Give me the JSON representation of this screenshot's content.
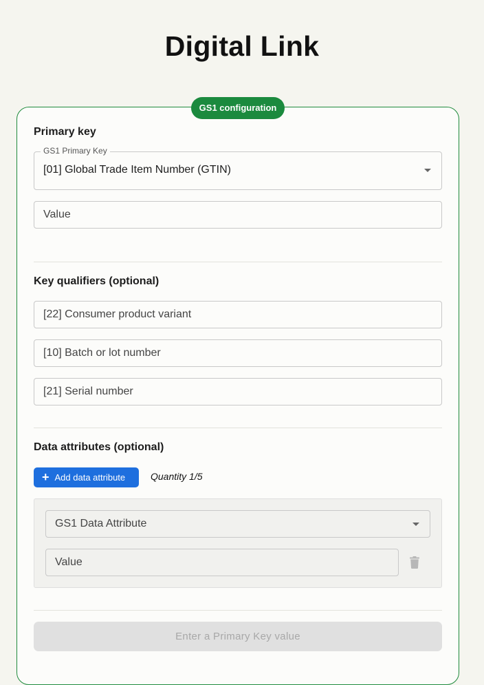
{
  "page": {
    "title": "Digital Link"
  },
  "card": {
    "badge": "GS1 configuration"
  },
  "primary_key": {
    "section_title": "Primary key",
    "select_label": "GS1 Primary Key",
    "select_value": "[01] Global Trade Item Number (GTIN)",
    "value_placeholder": "Value"
  },
  "key_qualifiers": {
    "section_title": "Key qualifiers (optional)",
    "fields": [
      {
        "placeholder": "[22] Consumer product variant"
      },
      {
        "placeholder": "[10] Batch or lot number"
      },
      {
        "placeholder": "[21] Serial number"
      }
    ]
  },
  "data_attributes": {
    "section_title": "Data attributes (optional)",
    "add_button_icon": "+",
    "add_button_label": "Add data attribute",
    "quantity": "Quantity 1/5",
    "items": [
      {
        "select_placeholder": "GS1 Data Attribute",
        "value_placeholder": "Value",
        "delete_icon": "trash-icon"
      }
    ]
  },
  "submit": {
    "label": "Enter a Primary Key value"
  },
  "colors": {
    "badge_green": "#1b8a3e",
    "card_border": "#1e8a3c",
    "button_blue": "#1e6fde",
    "page_bg": "#f5f5ef",
    "submit_disabled_bg": "#e0e0e0"
  }
}
